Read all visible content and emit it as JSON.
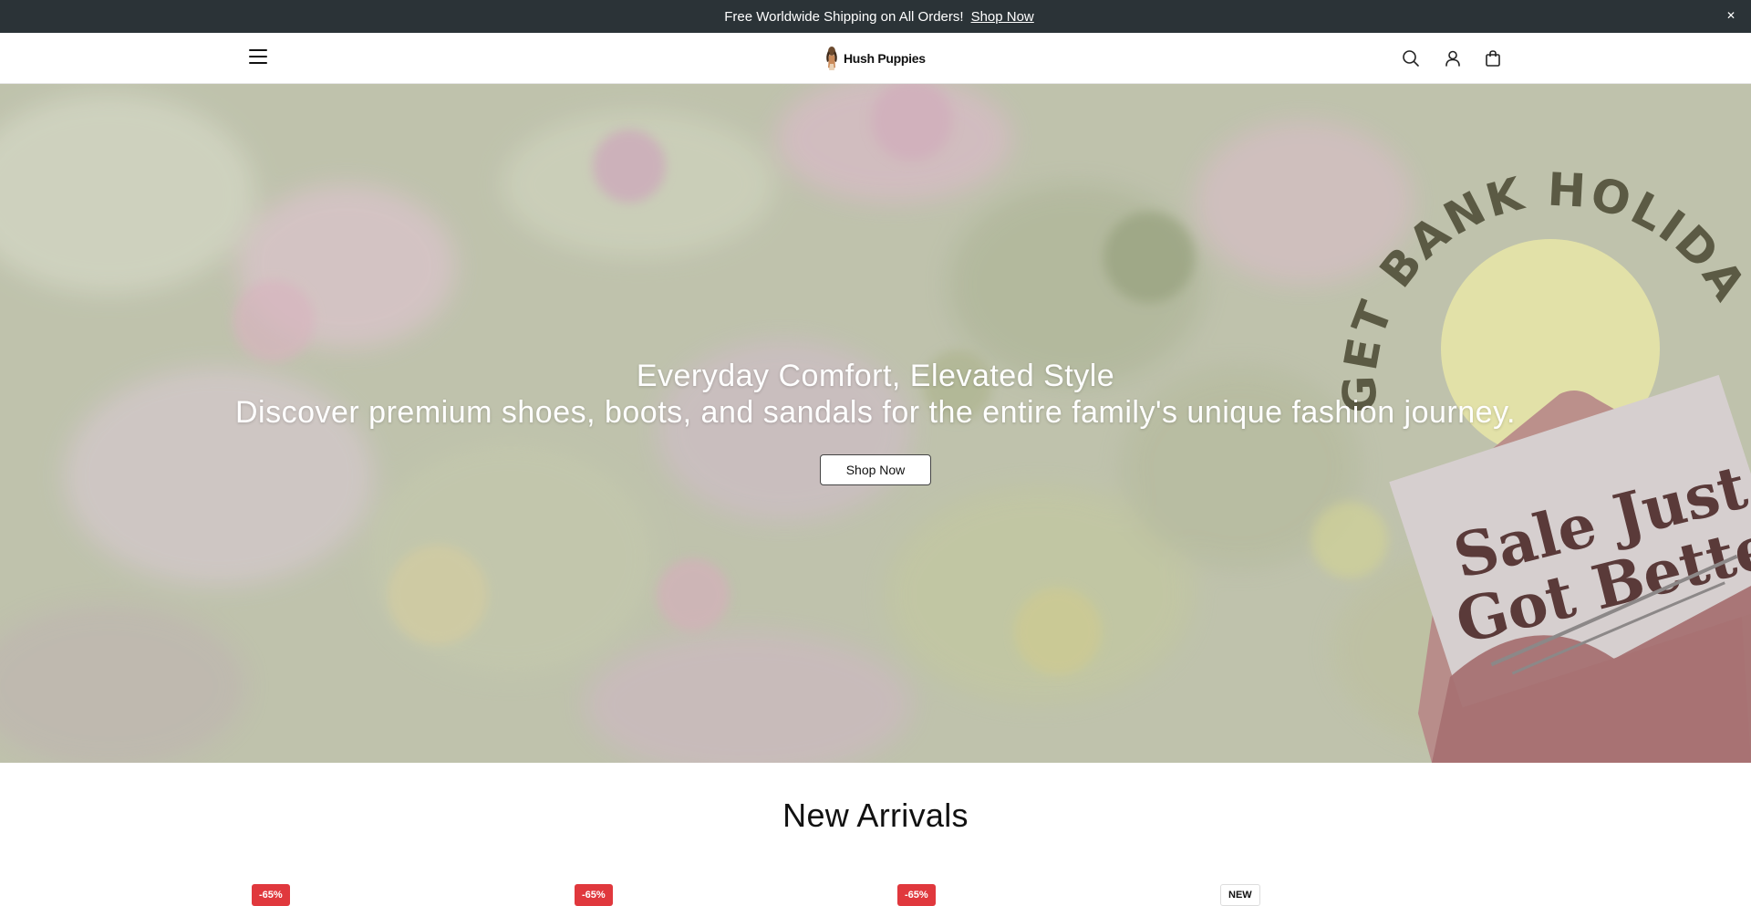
{
  "announcement": {
    "glyph": "",
    "text": "Free Worldwide Shipping on All Orders!",
    "link": "Shop Now",
    "close_icon": "close-icon"
  },
  "header": {
    "brand": "Hush Puppies",
    "icons": [
      "menu-icon",
      "search-icon",
      "user-icon",
      "bag-icon"
    ]
  },
  "hero": {
    "title": "Everyday Comfort, Elevated Style",
    "subtitle": "Discover premium shoes, boots, and sandals for the entire family's unique fashion journey.",
    "button": "Shop Now",
    "promo_arc": "GET BANK HOLIDAY READY",
    "promo_line1": "Sale Just",
    "promo_line2": "Got Better!"
  },
  "new_arrivals": {
    "title": "New Arrivals",
    "badges": [
      "-65%",
      "-65%",
      "-65%",
      "NEW"
    ]
  },
  "colors": {
    "announcement_bg": "#2b3337",
    "sale_badge": "#e0383d",
    "promo_text": "#5a3a39",
    "promo_arc": "#5b5a44"
  }
}
